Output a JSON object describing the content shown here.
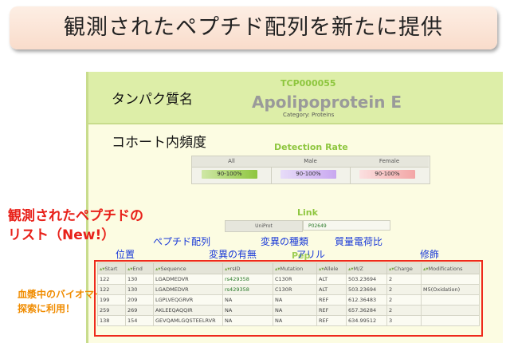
{
  "title": "観測されたペプチド配列を新たに提供",
  "panel": {
    "protein_label": "タンパク質名",
    "protein_id": "TCP000055",
    "protein_name": "Apolipoprotein E",
    "category": "Category: Proteins",
    "cohort_label": "コホート内頻度",
    "detection_rate": {
      "title": "Detection Rate",
      "columns": [
        {
          "label": "All",
          "value": "90-100%",
          "color": "#8ec63f"
        },
        {
          "label": "Male",
          "value": "90-100%",
          "color": "#c9a8f0"
        },
        {
          "label": "Female",
          "value": "90-100%",
          "color": "#f3a6a6"
        }
      ]
    },
    "link": {
      "title": "Link",
      "label": "UniProt",
      "value": "P02649"
    },
    "peptide_heading": "Peptide"
  },
  "annotations": {
    "observed_list_line1": "観測されたペプチドの",
    "observed_list_line2": "リスト（New!）",
    "position": "位置",
    "peptide_seq": "ペプチド配列",
    "variant_presence": "変異の有無",
    "variant_type": "変異の種類",
    "allele": "アリル",
    "mass_charge": "質量電荷比",
    "modification": "修飾",
    "biomarker_line1": "血漿中のバイオマーカー",
    "biomarker_line2": "探索に利用！"
  },
  "table": {
    "headers": [
      "Start",
      "End",
      "Sequence",
      "rsID",
      "Mutation",
      "Allele",
      "M/Z",
      "Charge",
      "Modifications"
    ],
    "rows": [
      [
        "122",
        "130",
        "LGADMEDVR",
        "rs429358",
        "C130R",
        "ALT",
        "503.23694",
        "2",
        ""
      ],
      [
        "122",
        "130",
        "LGADMEDVR",
        "rs429358",
        "C130R",
        "ALT",
        "503.23694",
        "2",
        "M5(Oxidation)"
      ],
      [
        "199",
        "209",
        "LGPLVEQGRVR",
        "NA",
        "NA",
        "REF",
        "612.36483",
        "2",
        ""
      ],
      [
        "259",
        "269",
        "AKLEEQAQQIR",
        "NA",
        "NA",
        "REF",
        "657.36284",
        "2",
        ""
      ],
      [
        "138",
        "154",
        "GEVQAMLGQSTEELRVR",
        "NA",
        "NA",
        "REF",
        "634.99512",
        "3",
        ""
      ]
    ]
  }
}
